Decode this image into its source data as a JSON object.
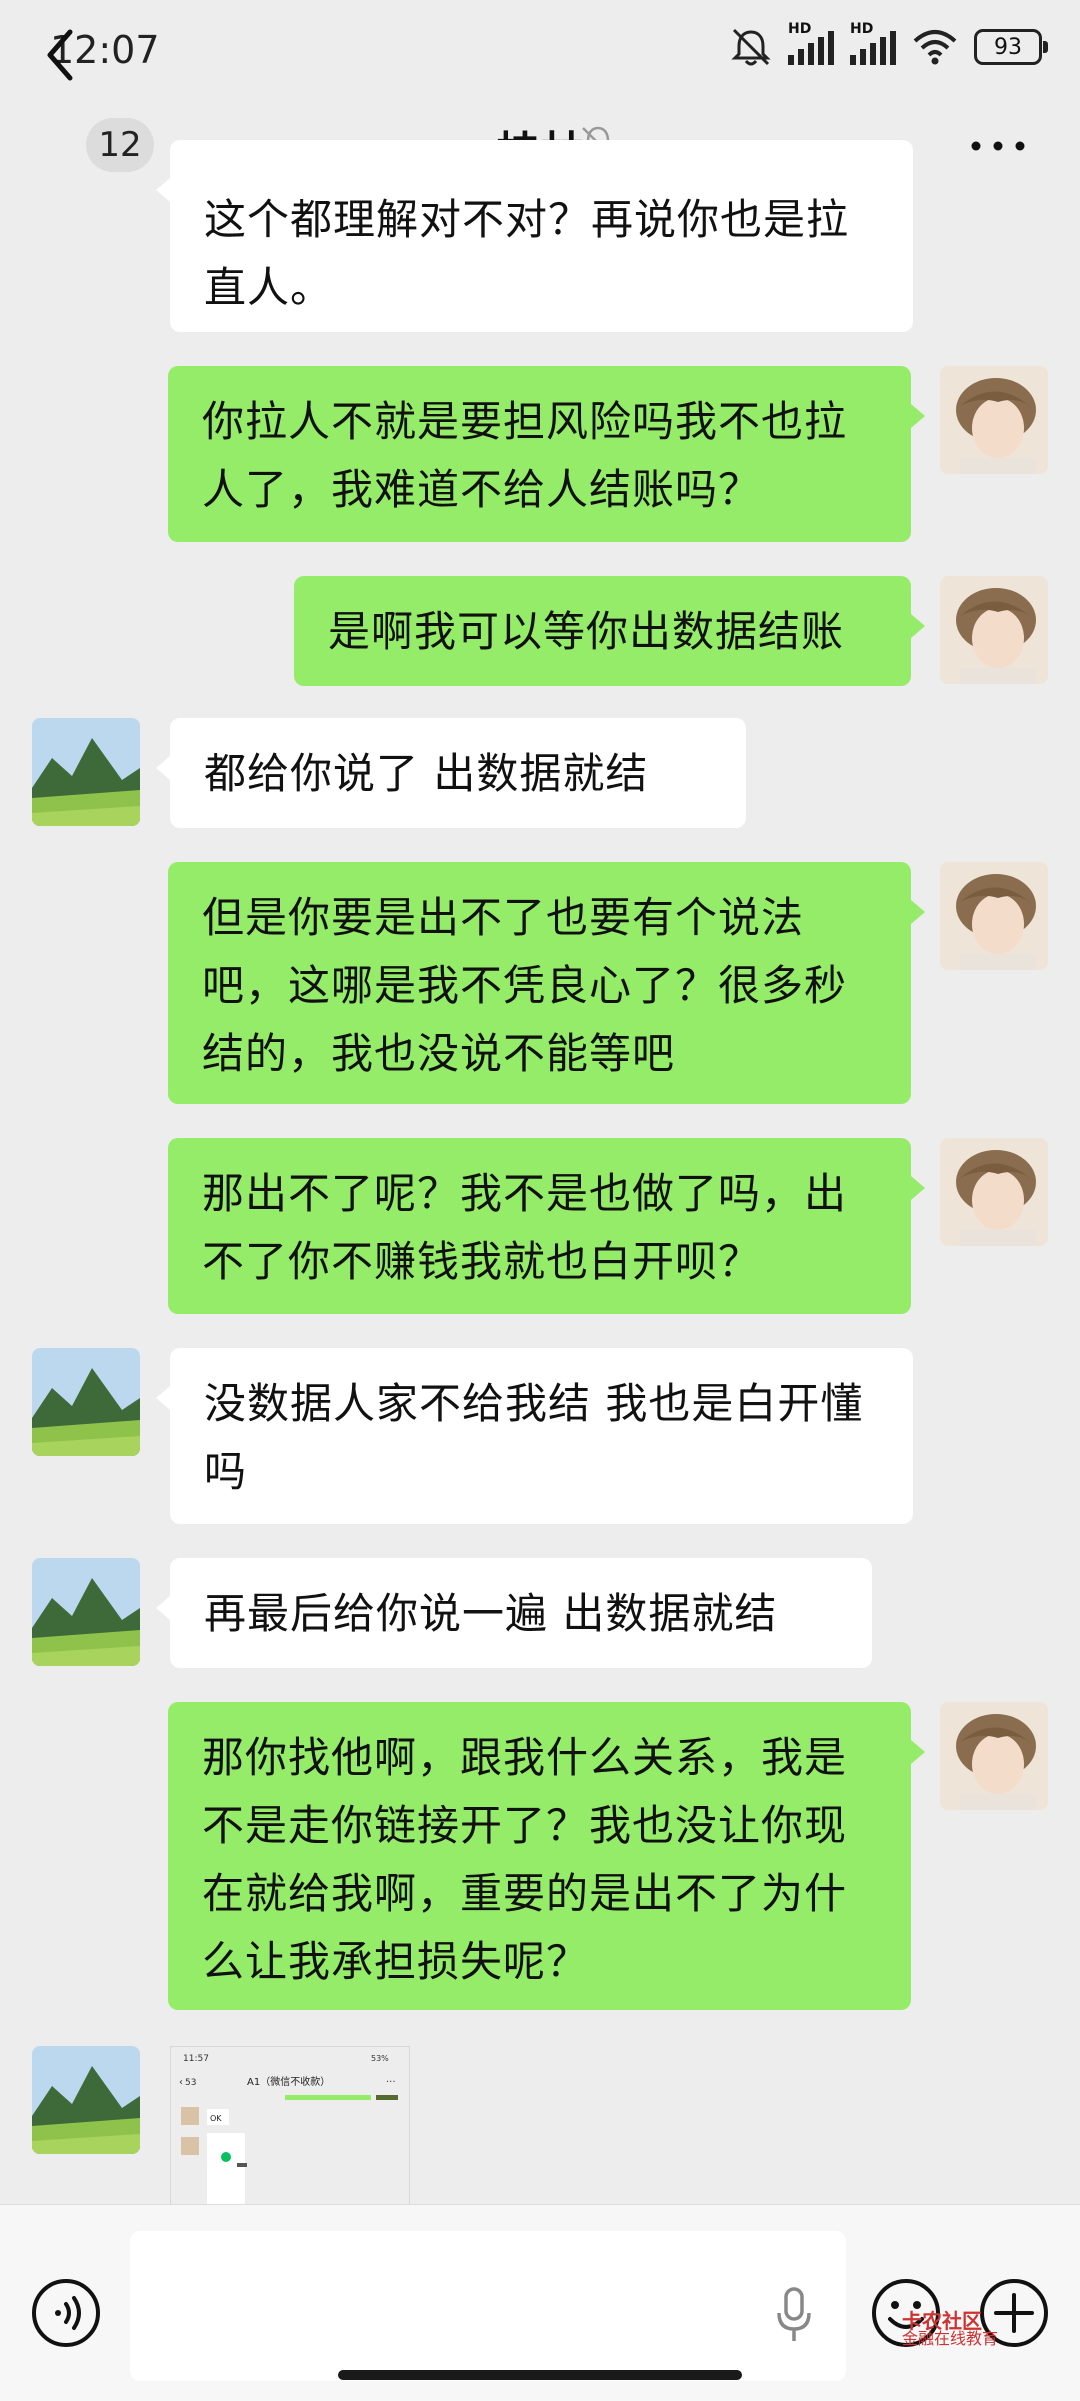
{
  "status_bar": {
    "time": "12:07",
    "battery": "93",
    "hd_1": "HD",
    "hd_2": "HD"
  },
  "header": {
    "unread_count": "12",
    "title": "桂林"
  },
  "messages": [
    {
      "side": "in",
      "text": "这个都理解对不对？再说你也是拉直人。"
    },
    {
      "side": "out",
      "text": "你拉人不就是要担风险吗我不也拉人了，我难道不给人结账吗？"
    },
    {
      "side": "out",
      "text": "是啊我可以等你出数据结账"
    },
    {
      "side": "in",
      "text": "都给你说了  出数据就结"
    },
    {
      "side": "out",
      "text": "但是你要是出不了也要有个说法吧，这哪是我不凭良心了？很多秒结的，我也没说不能等吧"
    },
    {
      "side": "out",
      "text": "那出不了呢？我不是也做了吗，出不了你不赚钱我就也白开呗？"
    },
    {
      "side": "in",
      "text": "没数据人家不给我结 我也是白开懂吗"
    },
    {
      "side": "in",
      "text": "再最后给你说一遍 出数据就结"
    },
    {
      "side": "out",
      "text": "那你找他啊，跟我什么关系，我是不是走你链接开了？我也没让你现在就给我啊，重要的是出不了为什么让我承担损失呢？"
    }
  ],
  "image_message": {
    "status_time": "11:57",
    "status_battery": "53%",
    "back_count": "53",
    "title": "A1（微信不收款）",
    "bubble_text": "OK"
  },
  "colors": {
    "background": "#ededed",
    "outgoing_bubble": "#95ec69",
    "incoming_bubble": "#ffffff",
    "bottom_bar": "#f7f7f7"
  },
  "icons": [
    "back-arrow-icon",
    "mute-bell-icon",
    "more-dots-icon",
    "voice-icon",
    "mic-icon",
    "emoji-icon",
    "plus-icon"
  ],
  "watermark": {
    "line1": "卡农社区",
    "line2": "金融在线教育"
  }
}
